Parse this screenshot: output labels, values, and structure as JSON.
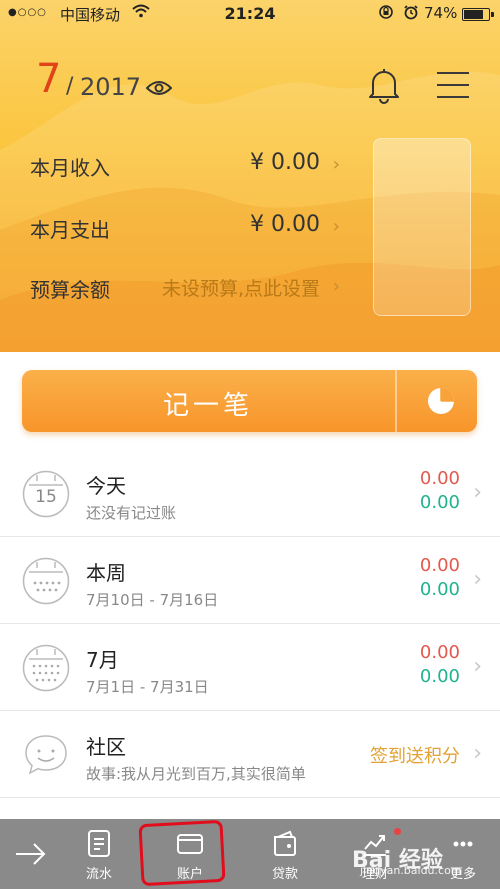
{
  "status": {
    "signal": "●○○○",
    "carrier": "中国移动",
    "time": "21:24",
    "battery": "74%"
  },
  "header": {
    "month": "7",
    "slash": "/",
    "year": "2017",
    "rows": [
      {
        "label": "本月收入",
        "value": "¥ 0.00"
      },
      {
        "label": "本月支出",
        "value": "¥ 0.00"
      },
      {
        "label": "预算余额",
        "value": "未设预算,点此设置"
      }
    ]
  },
  "record": {
    "label": "记一笔"
  },
  "list": [
    {
      "title": "今天",
      "sub": "还没有记过账",
      "red": "0.00",
      "green": "0.00",
      "calendar_day": "15"
    },
    {
      "title": "本周",
      "sub": "7月10日 - 7月16日",
      "red": "0.00",
      "green": "0.00"
    },
    {
      "title": "7月",
      "sub": "7月1日 - 7月31日",
      "red": "0.00",
      "green": "0.00"
    },
    {
      "title": "社区",
      "sub": "故事:我从月光到百万,其实很简单",
      "action": "签到送积分"
    }
  ],
  "tabs": [
    {
      "label": "流水",
      "icon": "ledger-icon"
    },
    {
      "label": "账户",
      "icon": "wallet-icon"
    },
    {
      "label": "贷款",
      "icon": "loan-icon"
    },
    {
      "label": "理财",
      "icon": "chart-icon"
    },
    {
      "label": "更多",
      "icon": "more-icon"
    }
  ],
  "watermark": {
    "text": "Bai 经验",
    "url": "jingyan.baidu.com"
  },
  "colors": {
    "month": "#e0421a",
    "accent_orange": "#f7952a",
    "amount_red": "#e25a4e",
    "amount_green": "#21b28f",
    "tabbar": "#8a8a8a",
    "annotation": "#e10d1d"
  }
}
